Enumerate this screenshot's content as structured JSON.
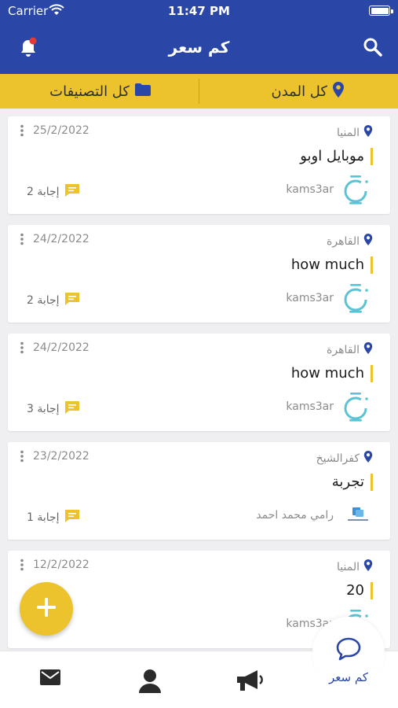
{
  "status": {
    "carrier": "Carrier",
    "time": "11:47 PM"
  },
  "header": {
    "title": "كم سعر"
  },
  "filters": {
    "cities": "كل المدن",
    "categories": "كل التصنيفات"
  },
  "questions": [
    {
      "date": "25/2/2022",
      "location": "المنيا",
      "title": "موبايل اوبو",
      "answers": "2 إجابة",
      "author": "kams3ar",
      "avatar": "logo-ring"
    },
    {
      "date": "24/2/2022",
      "location": "القاهرة",
      "title": "how much",
      "answers": "2 إجابة",
      "author": "kams3ar",
      "avatar": "logo-ring"
    },
    {
      "date": "24/2/2022",
      "location": "القاهرة",
      "title": "how much",
      "answers": "3 إجابة",
      "author": "kams3ar",
      "avatar": "logo-ring"
    },
    {
      "date": "23/2/2022",
      "location": "كفرالشيخ",
      "title": "تجربة",
      "answers": "1 إجابة",
      "author": "رامي محمد احمد",
      "avatar": "user-photo"
    },
    {
      "date": "12/2/2022",
      "location": "المنيا",
      "title": "20",
      "answers": "",
      "author": "kams3ar",
      "avatar": "logo-ring"
    }
  ],
  "nav": {
    "active_label": "كم سعر",
    "items": [
      "mail-icon",
      "person-icon",
      "megaphone-icon",
      "chat-icon"
    ]
  },
  "colors": {
    "primary": "#2a46a6",
    "accent": "#ecc32c",
    "logo": "#5bc3d6"
  }
}
